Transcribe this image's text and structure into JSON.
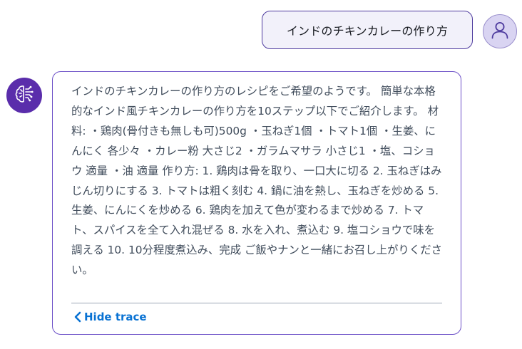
{
  "conversation": {
    "user_message": {
      "text": "インドのチキンカレーの作り方",
      "avatar_icon": "user-icon"
    },
    "assistant_message": {
      "avatar_icon": "brain-circuit-icon",
      "text": "インドのチキンカレーの作り方のレシピをご希望のようです。 簡単な本格的なインド風チキンカレーの作り方を10ステップ以下でご紹介します。 材料: ・鶏肉(骨付きも無しも可)500g ・玉ねぎ1個 ・トマト1個 ・生姜、にんにく 各少々 ・カレー粉 大さじ2 ・ガラムマサラ 小さじ1 ・塩、コショウ 適量 ・油 適量 作り方: 1. 鶏肉は骨を取り、一口大に切る 2. 玉ねぎはみじん切りにする 3. トマトは粗く刻む 4. 鍋に油を熱し、玉ねぎを炒める 5. 生姜、にんにくを炒める 6. 鶏肉を加えて色が変わるまで炒める 7. トマト、スパイスを全て入れ混ぜる 8. 水を入れ、煮込む 9. 塩コショウで味を調える 10. 10分程度煮込み、完成 ご飯やナンと一緒にお召し上がりください。",
      "trace_toggle_label": "Hide trace",
      "trace_toggle_icon": "chevron-left-icon"
    }
  },
  "colors": {
    "accent": "#5a2dab",
    "bubble_border": "#6b4fc7",
    "link": "#0972d3",
    "user_bubble_bg": "#f2f1fa"
  }
}
